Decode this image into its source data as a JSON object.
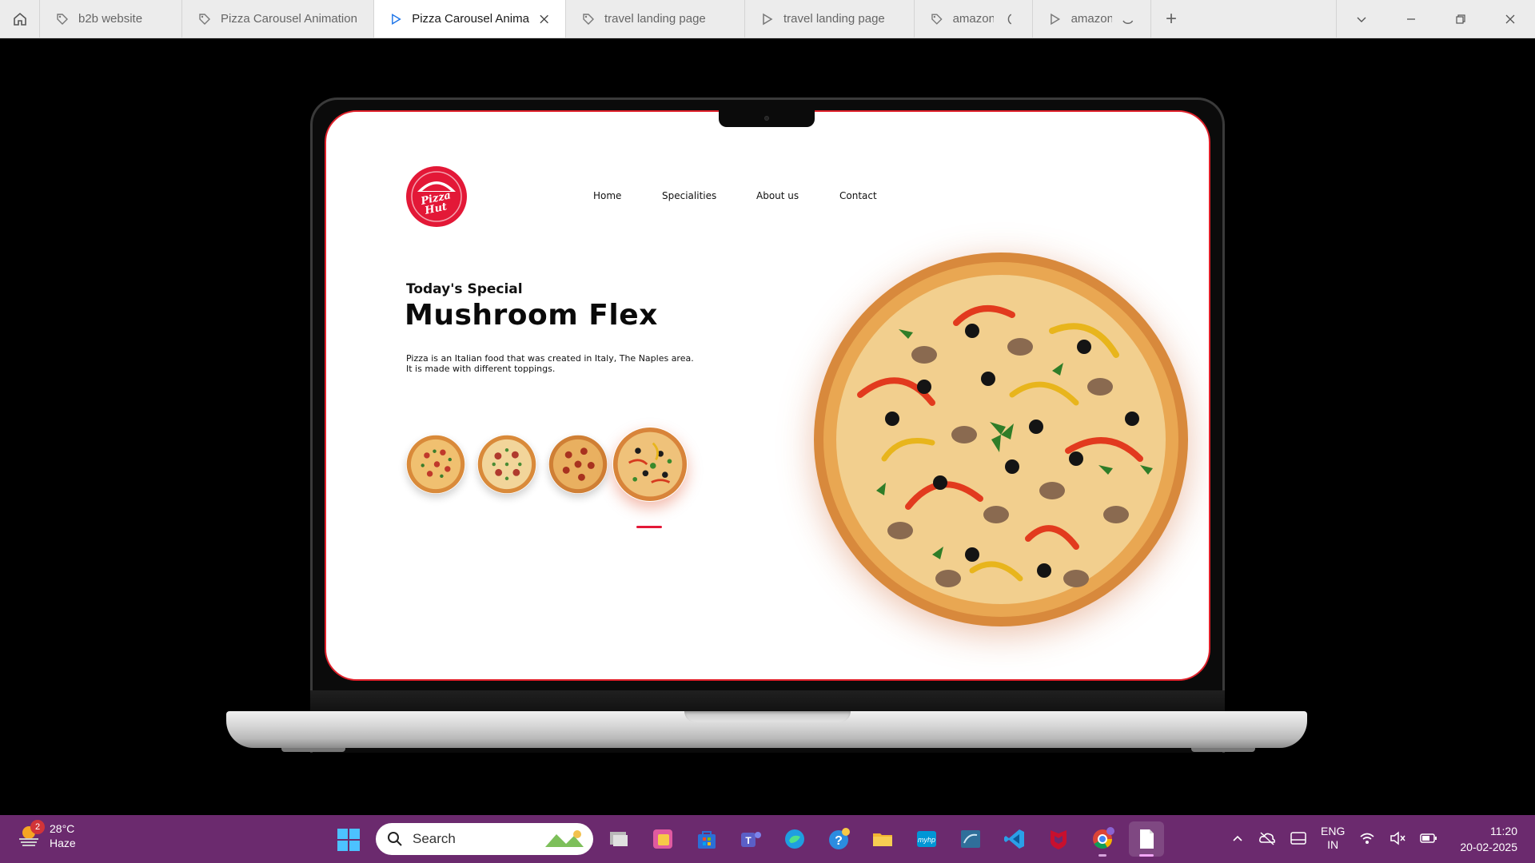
{
  "browser": {
    "tabs": [
      {
        "label": "b2b website",
        "icon": "tag-icon",
        "active": false
      },
      {
        "label": "Pizza Carousel Animation",
        "icon": "tag-icon",
        "active": false
      },
      {
        "label": "Pizza Carousel Animati",
        "icon": "play-icon",
        "active": true
      },
      {
        "label": "travel landing page",
        "icon": "tag-icon",
        "active": false
      },
      {
        "label": "travel landing page",
        "icon": "play-icon",
        "active": false
      },
      {
        "label": "amazon",
        "icon": "tag-icon",
        "active": false
      },
      {
        "label": "amazon",
        "icon": "play-icon",
        "active": false
      }
    ],
    "new_tab": "+"
  },
  "site": {
    "brand": "Pizza Hut",
    "nav": [
      "Home",
      "Specialities",
      "About us",
      "Contact"
    ],
    "subheading": "Today's Special",
    "heading": "Mushroom Flex",
    "description": "Pizza is an Italian food that was created in Italy, The Naples area. It is made with different toppings.",
    "carousel_count": 4,
    "active_slide": 4,
    "accent_color": "#e31837"
  },
  "taskbar": {
    "weather": {
      "temp": "28°C",
      "condition": "Haze",
      "badge": "2"
    },
    "search_placeholder": "Search",
    "apps": [
      "file-explorer-app",
      "photos-app",
      "store-app",
      "teams-app",
      "edge-app",
      "help-app",
      "folder-app",
      "myhp-app",
      "sql-app",
      "vscode-app",
      "mcafee-app",
      "chrome-app",
      "notepad-app"
    ],
    "lang": {
      "line1": "ENG",
      "line2": "IN"
    },
    "time": "11:20",
    "date": "20-02-2025",
    "color": "#6b2a6e"
  }
}
